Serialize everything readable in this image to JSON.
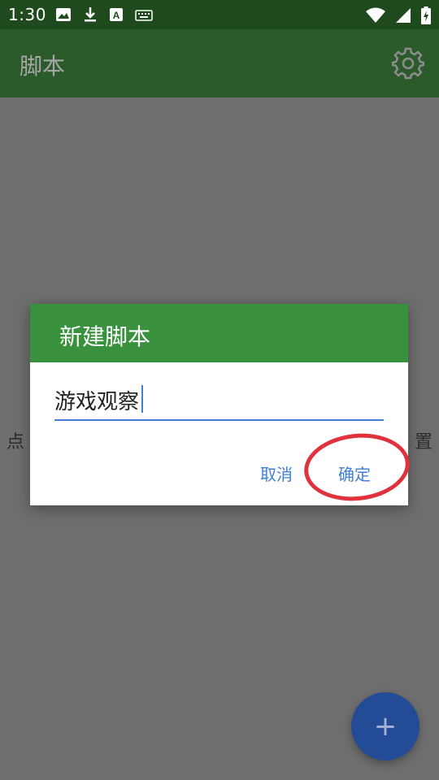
{
  "status_bar": {
    "time": "1:30",
    "left_icons": [
      "image-icon",
      "download-icon",
      "text-a-icon",
      "keyboard-icon"
    ],
    "right_icons": [
      "wifi-icon",
      "cell-signal-icon",
      "battery-icon"
    ]
  },
  "app_bar": {
    "title": "脚本",
    "settings_icon": "gear-icon"
  },
  "background": {
    "hint_left": "点",
    "hint_right": "置"
  },
  "dialog": {
    "title": "新建脚本",
    "input_value": "游戏观察",
    "cancel_label": "取消",
    "ok_label": "确定"
  },
  "fab": {
    "label": "+"
  },
  "colors": {
    "status_bar": "#1f4a1d",
    "app_bar": "#2b5a2b",
    "dialog_header": "#3a913d",
    "accent": "#3f7fd8",
    "highlight": "#e0323d",
    "fab": "#244c96"
  }
}
